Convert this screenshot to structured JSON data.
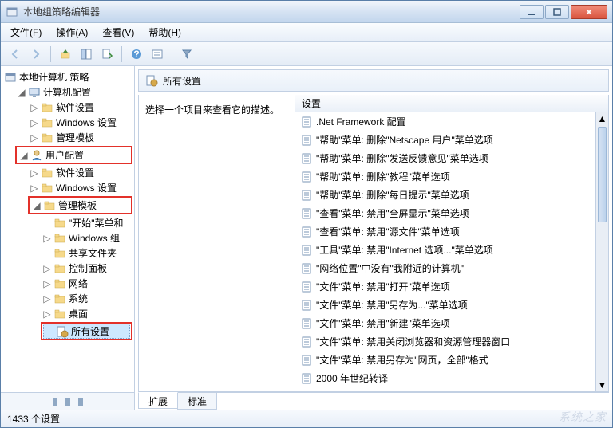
{
  "window": {
    "title": "本地组策略编辑器"
  },
  "menu": {
    "file": "文件(F)",
    "action": "操作(A)",
    "view": "查看(V)",
    "help": "帮助(H)"
  },
  "tree": {
    "root": "本地计算机 策略",
    "computer_config": "计算机配置",
    "cc_software": "软件设置",
    "cc_windows": "Windows 设置",
    "cc_admin": "管理模板",
    "user_config": "用户配置",
    "uc_software": "软件设置",
    "uc_windows": "Windows 设置",
    "uc_admin": "管理模板",
    "start_menu": "\"开始\"菜单和",
    "windows_comp": "Windows 组",
    "shared_folders": "共享文件夹",
    "control_panel": "控制面板",
    "network": "网络",
    "system": "系统",
    "desktop": "桌面",
    "all_settings": "所有设置"
  },
  "right": {
    "header": "所有设置",
    "desc": "选择一个项目来查看它的描述。",
    "col_setting": "设置",
    "items": [
      ".Net Framework 配置",
      "\"帮助\"菜单: 删除\"Netscape 用户\"菜单选项",
      "\"帮助\"菜单: 删除\"发送反馈意见\"菜单选项",
      "\"帮助\"菜单: 删除\"教程\"菜单选项",
      "\"帮助\"菜单: 删除\"每日提示\"菜单选项",
      "\"查看\"菜单: 禁用\"全屏显示\"菜单选项",
      "\"查看\"菜单: 禁用\"源文件\"菜单选项",
      "\"工具\"菜单: 禁用\"Internet 选项...\"菜单选项",
      "\"网络位置\"中没有\"我附近的计算机\"",
      "\"文件\"菜单: 禁用\"打开\"菜单选项",
      "\"文件\"菜单: 禁用\"另存为...\"菜单选项",
      "\"文件\"菜单: 禁用\"新建\"菜单选项",
      "\"文件\"菜单: 禁用关闭浏览器和资源管理器窗口",
      "\"文件\"菜单: 禁用另存为\"网页，全部\"格式",
      "2000 年世纪转译"
    ]
  },
  "tabs": {
    "extended": "扩展",
    "standard": "标准"
  },
  "status": "1433 个设置",
  "watermark": "系统之家"
}
